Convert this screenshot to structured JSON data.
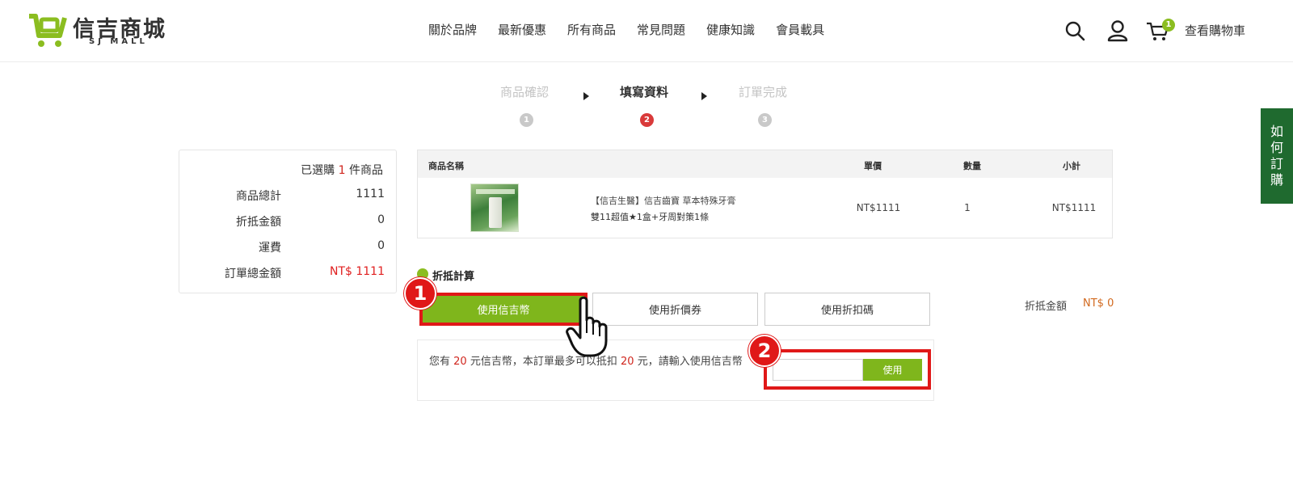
{
  "brand": {
    "name_cn": "信吉商城",
    "name_en": "SJ MALL",
    "color": "#8bbd20"
  },
  "nav": {
    "items": [
      "關於品牌",
      "最新優惠",
      "所有商品",
      "常見問題",
      "健康知識",
      "會員載具"
    ]
  },
  "header_icons": [
    "search-icon",
    "user-icon",
    "cart-icon"
  ],
  "cart": {
    "badge": "1",
    "label": "查看購物車"
  },
  "steps": [
    {
      "label": "商品確認",
      "num": "1",
      "active": false
    },
    {
      "label": "填寫資料",
      "num": "2",
      "active": true
    },
    {
      "label": "訂單完成",
      "num": "3",
      "active": false
    }
  ],
  "summary": {
    "selected_prefix": "已選購",
    "selected_count": "1",
    "selected_suffix": "件商品",
    "rows": [
      {
        "label": "商品總計",
        "value": "1111"
      },
      {
        "label": "折抵金額",
        "value": "0"
      },
      {
        "label": "運費",
        "value": "0"
      },
      {
        "label": "訂單總金額",
        "value": "NT$ 1111"
      }
    ]
  },
  "table": {
    "headers": {
      "name": "商品名稱",
      "price": "單價",
      "qty": "數量",
      "subtotal": "小計"
    },
    "rows": [
      {
        "name_line1": "【信吉生醫】信吉齒寶 草本特殊牙膏",
        "name_line2": "雙11超值★1盒+牙周對策1條",
        "price": "NT$1111",
        "qty": "1",
        "subtotal": "NT$1111"
      }
    ]
  },
  "discount": {
    "title": "折抵計算",
    "tabs": [
      {
        "label": "使用信吉幣",
        "active": true
      },
      {
        "label": "使用折價券",
        "active": false
      },
      {
        "label": "使用折扣碼",
        "active": false
      }
    ],
    "amount_label": "折抵金額",
    "amount_value": "NT$ 0"
  },
  "coin": {
    "text_1": "您有",
    "coins": "20",
    "text_2": "元信吉幣，本訂單最多可以抵扣",
    "max": "20",
    "text_3": "元，請輸入使用信吉幣",
    "input_value": "",
    "use_label": "使用"
  },
  "callouts": [
    "1",
    "2"
  ],
  "side_tab": {
    "chars": [
      "如",
      "何",
      "訂",
      "購"
    ]
  },
  "colors": {
    "accent_green": "#7fb61c",
    "highlight_red": "#e01818",
    "total_red": "#e02020",
    "side_green": "#1f6a2f"
  }
}
